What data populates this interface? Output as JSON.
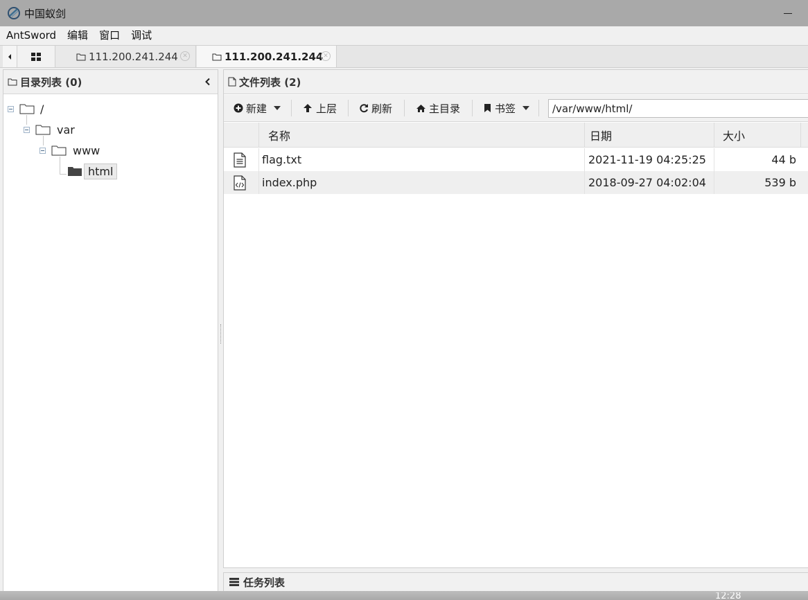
{
  "window": {
    "title": "中国蚁剑"
  },
  "menu": [
    "AntSword",
    "编辑",
    "窗口",
    "调试"
  ],
  "tabs": [
    {
      "label": "111.200.241.244",
      "active": false
    },
    {
      "label": "111.200.241.244",
      "active": true
    }
  ],
  "left_panel": {
    "title": "目录列表 (0)",
    "tree": {
      "root": "/",
      "level1": "var",
      "level2": "www",
      "level3": "html"
    }
  },
  "right_panel": {
    "title": "文件列表 (2)",
    "toolbar": {
      "new_label": "新建",
      "up_label": "上层",
      "refresh_label": "刷新",
      "home_label": "主目录",
      "bookmark_label": "书签"
    },
    "path": "/var/www/html/",
    "columns": {
      "name": "名称",
      "date": "日期",
      "size": "大小"
    },
    "files": [
      {
        "name": "flag.txt",
        "date": "2021-11-19 04:25:25",
        "size": "44 b",
        "icon": "text-file-icon"
      },
      {
        "name": "index.php",
        "date": "2018-09-27 04:02:04",
        "size": "539 b",
        "icon": "code-file-icon"
      }
    ]
  },
  "task_panel": {
    "title": "任务列表"
  },
  "taskbar": {
    "clock": "12:28"
  },
  "colors": {
    "titlebar": "#a9a9a9",
    "panel_header": "#f1f1f1",
    "row_alt": "#efefef"
  }
}
